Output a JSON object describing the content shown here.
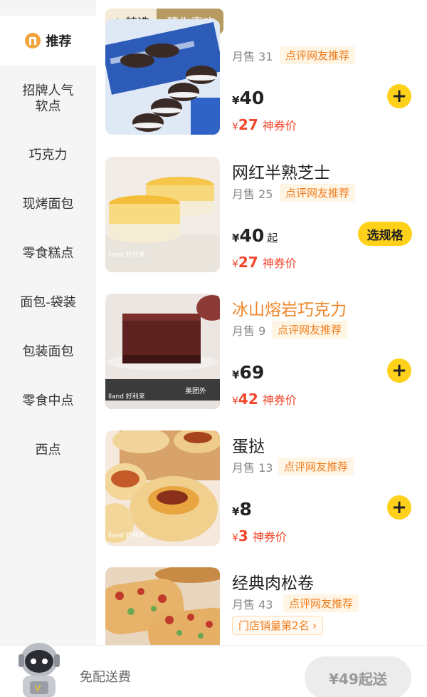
{
  "sidebar": {
    "active": {
      "label": "推荐",
      "icon": "recommend-icon"
    },
    "items": [
      {
        "label": "招牌人气\n软点"
      },
      {
        "label": "巧克力"
      },
      {
        "label": "现烤面包"
      },
      {
        "label": "零食糕点"
      },
      {
        "label": "面包-袋装"
      },
      {
        "label": "包装面包"
      },
      {
        "label": "零食中点"
      },
      {
        "label": "西点"
      }
    ]
  },
  "tags": {
    "selected": "精选",
    "other": "猜你喜欢"
  },
  "products": [
    {
      "name": "",
      "sales": "月售 31",
      "tag": "点评网友推荐",
      "price_symbol": "¥",
      "price": "40",
      "coupon_symbol": "¥",
      "coupon_price": "27",
      "coupon_label": "神券价",
      "action": "+"
    },
    {
      "name": "网红半熟芝士",
      "sales": "月售 25",
      "tag": "点评网友推荐",
      "price_symbol": "¥",
      "price": "40",
      "price_suffix": "起",
      "coupon_symbol": "¥",
      "coupon_price": "27",
      "coupon_label": "神券价",
      "action": "选规格"
    },
    {
      "name": "冰山熔岩巧克力",
      "sales": "月售 9",
      "tag": "点评网友推荐",
      "price_symbol": "¥",
      "price": "69",
      "coupon_symbol": "¥",
      "coupon_price": "42",
      "coupon_label": "神券价",
      "action": "+"
    },
    {
      "name": "蛋挞",
      "sales": "月售 13",
      "tag": "点评网友推荐",
      "price_symbol": "¥",
      "price": "8",
      "coupon_symbol": "¥",
      "coupon_price": "3",
      "coupon_label": "神券价",
      "action": "+"
    },
    {
      "name": "经典肉松卷",
      "sales": "月售 43",
      "tag": "点评网友推荐",
      "rank": "门店销量第2名 ›"
    }
  ],
  "bottom": {
    "free_delivery": "免配送费",
    "min_order": "¥49起送"
  },
  "colors": {
    "accent_yellow": "#ffd11a",
    "coupon_red": "#f2472d",
    "tag_orange": "#f07c1c",
    "gold": "#b69a62"
  }
}
